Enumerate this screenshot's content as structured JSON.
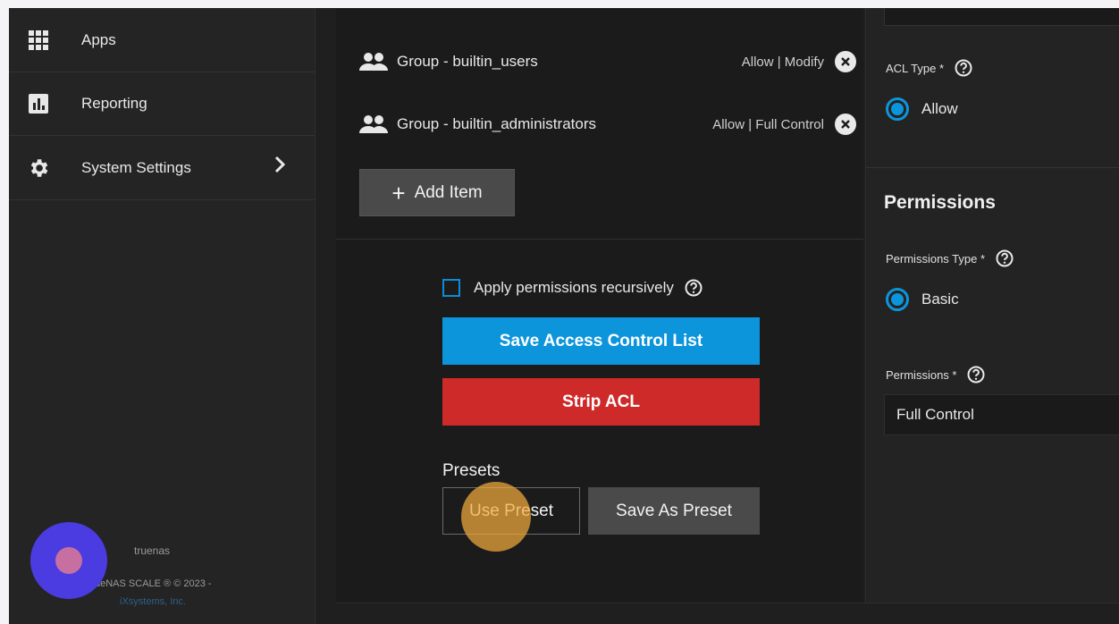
{
  "sidebar": {
    "items": [
      {
        "label": "Apps",
        "icon": "apps-grid-icon"
      },
      {
        "label": "Reporting",
        "icon": "reporting-chart-icon"
      },
      {
        "label": "System Settings",
        "icon": "gear-icon",
        "has_submenu": true
      }
    ],
    "footer": {
      "hostname": "truenas",
      "copyright": "ueNAS SCALE ® © 2023 -",
      "company": "iXsystems, Inc."
    }
  },
  "acl": {
    "entries": [
      {
        "who": "Group - builtin_users",
        "permission": "Allow | Modify"
      },
      {
        "who": "Group - builtin_administrators",
        "permission": "Allow | Full Control"
      }
    ],
    "add_item_label": "Add Item",
    "apply_recursive_label": "Apply permissions recursively",
    "save_label": "Save Access Control List",
    "strip_label": "Strip ACL",
    "presets_title": "Presets",
    "use_preset_label": "Use Preset",
    "save_as_preset_label": "Save As Preset"
  },
  "editor": {
    "acl_type_label": "ACL Type *",
    "acl_type_value": "Allow",
    "permissions_section_title": "Permissions",
    "permissions_type_label": "Permissions Type *",
    "permissions_type_value": "Basic",
    "permissions_label": "Permissions *",
    "permissions_value": "Full Control"
  },
  "colors": {
    "primary": "#0d95dc",
    "danger": "#cf2a2a",
    "background": "#1f1f1f"
  }
}
